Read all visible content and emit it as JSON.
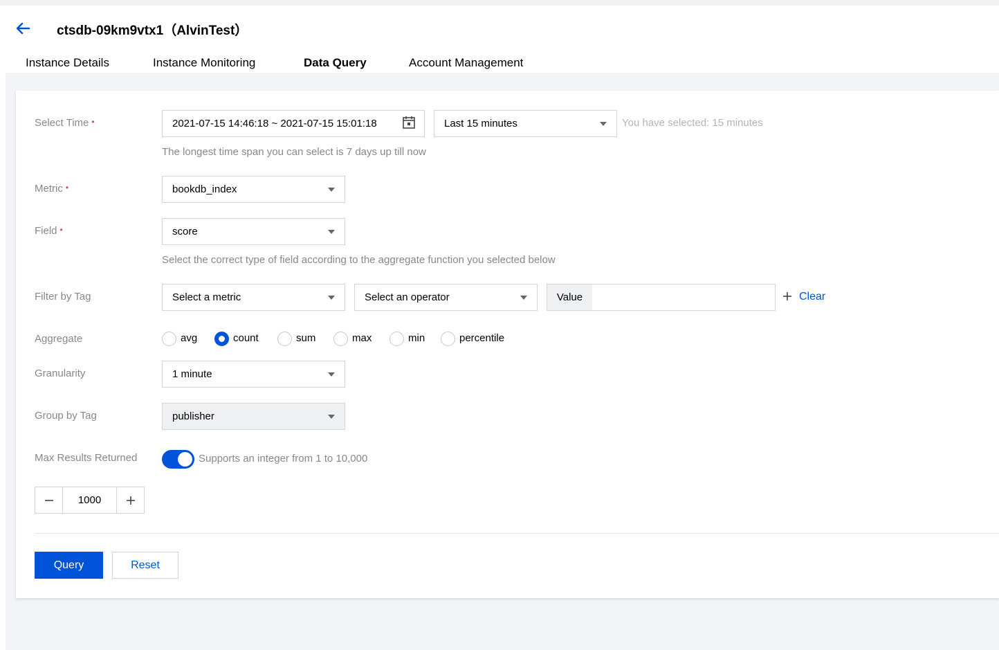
{
  "header": {
    "title": "ctsdb-09km9vtx1（AlvinTest）",
    "back_icon": "arrow-left-icon"
  },
  "tabs": [
    {
      "label": "Instance Details",
      "active": false
    },
    {
      "label": "Instance Monitoring",
      "active": false
    },
    {
      "label": "Data Query",
      "active": true
    },
    {
      "label": "Account Management",
      "active": false
    }
  ],
  "form": {
    "select_time": {
      "label": "Select Time",
      "range_value": "2021-07-15 14:46:18 ~ 2021-07-15 15:01:18",
      "preset_value": "Last 15 minutes",
      "selected_hint": "You have selected: 15 minutes",
      "help": "The longest time span you can select is 7 days up till now"
    },
    "metric": {
      "label": "Metric",
      "value": "bookdb_index"
    },
    "field": {
      "label": "Field",
      "value": "score",
      "help": "Select the correct type of field according to the aggregate function you selected below"
    },
    "filter_by_tag": {
      "label": "Filter by Tag",
      "metric_placeholder": "Select a metric",
      "operator_placeholder": "Select an operator",
      "value_addon": "Value",
      "value": "",
      "clear_label": "Clear"
    },
    "aggregate": {
      "label": "Aggregate",
      "options": [
        "avg",
        "count",
        "sum",
        "max",
        "min",
        "percentile"
      ],
      "selected": "count"
    },
    "granularity": {
      "label": "Granularity",
      "value": "1 minute"
    },
    "group_by_tag": {
      "label": "Group by Tag",
      "value": "publisher"
    },
    "max_results": {
      "label": "Max Results Returned",
      "enabled": true,
      "hint": "Supports an integer from 1 to 10,000",
      "value": "1000"
    }
  },
  "actions": {
    "query_label": "Query",
    "reset_label": "Reset"
  },
  "colors": {
    "accent": "#0052d9",
    "required": "#e54545",
    "muted_text": "#888888",
    "background": "#f3f4f7"
  }
}
